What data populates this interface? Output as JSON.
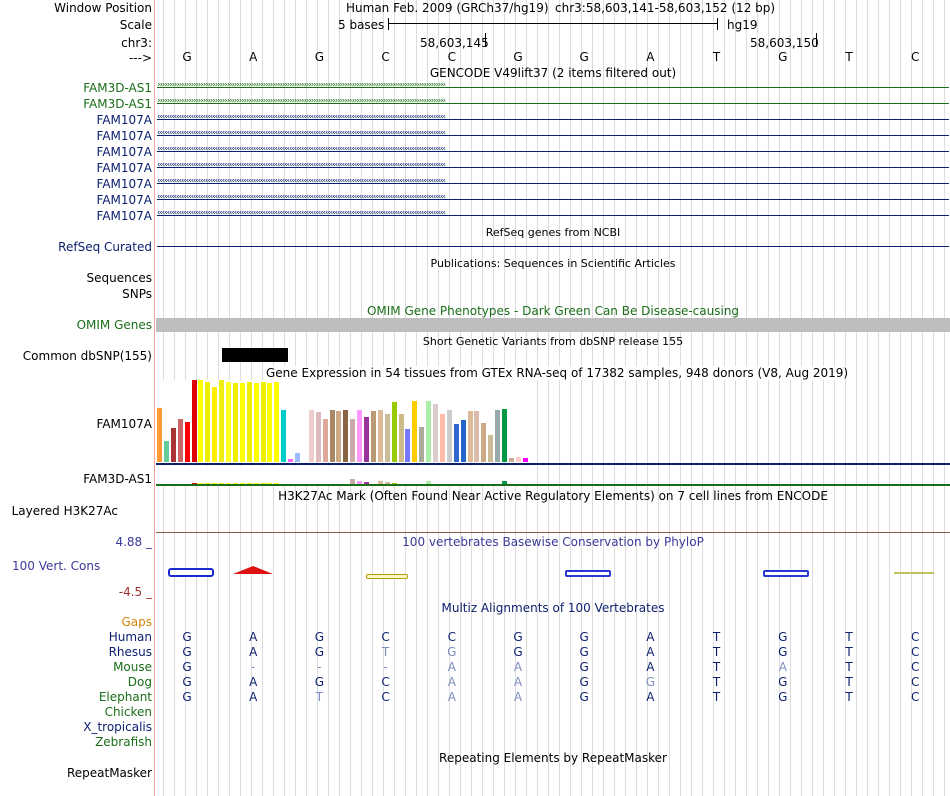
{
  "header": {
    "window_position_label": "Window Position",
    "assembly_title": "Human Feb. 2009 (GRCh37/hg19)",
    "position": "chr3:58,603,141-58,603,152 (12 bp)",
    "scale_label": "Scale",
    "scale_text": "5 bases",
    "scale_db": "hg19",
    "chrom_label": "chr3:",
    "coord_1": "58,603,145",
    "coord_2": "58,603,150",
    "strand_label": "--->"
  },
  "colors": {
    "dark_green": "#1a6e1a",
    "navy": "#0a1f6e",
    "omim_gray": "#bebebe",
    "phylop_blue": "#3a3a9a",
    "gaps_orange": "#d4860c",
    "divider": "#f3a3a3"
  },
  "bases": [
    "G",
    "A",
    "G",
    "C",
    "C",
    "G",
    "G",
    "A",
    "T",
    "G",
    "T",
    "C"
  ],
  "gencode": {
    "title": "GENCODE V49lift37 (2 items filtered out)",
    "tracks": [
      {
        "label": "FAM3D-AS1",
        "strand": "+"
      },
      {
        "label": "FAM3D-AS1",
        "strand": "+"
      },
      {
        "label": "FAM107A",
        "strand": "-"
      },
      {
        "label": "FAM107A",
        "strand": "-"
      },
      {
        "label": "FAM107A",
        "strand": "-"
      },
      {
        "label": "FAM107A",
        "strand": "-"
      },
      {
        "label": "FAM107A",
        "strand": "-"
      },
      {
        "label": "FAM107A",
        "strand": "-"
      },
      {
        "label": "FAM107A",
        "strand": "-"
      }
    ]
  },
  "refseq": {
    "title": "RefSeq genes from NCBI",
    "label": "RefSeq Curated"
  },
  "publications": {
    "title": "Publications: Sequences in Scientific Articles",
    "label_sequences": "Sequences",
    "label_snps": "SNPs"
  },
  "omim": {
    "title": "OMIM Gene Phenotypes - Dark Green Can Be Disease-causing",
    "label": "OMIM Genes"
  },
  "dbsnp": {
    "title": "Short Genetic Variants from dbSNP release 155",
    "label": "Common dbSNP(155)"
  },
  "gtex": {
    "title": "Gene Expression in 54 tissues from GTEx RNA-seq of 17382 samples, 948 donors (V8, Aug 2019)",
    "gene1_label": "FAM107A",
    "gene2_label": "FAM3D-AS1",
    "tissue_colors": [
      "#ff9933",
      "#66cc99",
      "#aa3333",
      "#cc6666",
      "#ff0000",
      "#dd0000",
      "#ffff00",
      "#eeee00",
      "#ffee00",
      "#eeee11",
      "#ffff22",
      "#eeee00",
      "#ffff00",
      "#eeee00",
      "#ffff00",
      "#eeee00",
      "#ffff00",
      "#ffff00",
      "#00cccc",
      "#ff66ff",
      "#99bbff",
      "#ffffff",
      "#eecccc",
      "#ddbbbb",
      "#ddaa99",
      "#aa8866",
      "#ccaa88",
      "#886644",
      "#ccaaaa",
      "#ff99ff",
      "#993399",
      "#bb9977",
      "#ddbb99",
      "#ccbb99",
      "#99cc00",
      "#ccbb88",
      "#7777ff",
      "#ffcc00",
      "#aaaa99",
      "#aaeeaa",
      "#ddcccc",
      "#ffbbaa",
      "#cccccc",
      "#3366cc",
      "#2266cc",
      "#ddbb99",
      "#ddbbaa",
      "#ccaa88",
      "#ccbb99",
      "#99aaaa",
      "#009944",
      "#ccaa99",
      "#ffcccc",
      "#ff00ff"
    ],
    "gene1_values": [
      0.66,
      0.26,
      0.42,
      0.52,
      0.49,
      1.0,
      1.0,
      0.98,
      0.92,
      1.0,
      0.98,
      0.96,
      0.96,
      0.98,
      0.96,
      0.98,
      0.96,
      0.98,
      0.64,
      0.04,
      0.11,
      0.01,
      0.63,
      0.61,
      0.52,
      0.64,
      0.62,
      0.64,
      0.52,
      0.64,
      0.55,
      0.62,
      0.64,
      0.59,
      0.73,
      0.58,
      0.4,
      0.74,
      0.43,
      0.74,
      0.71,
      0.58,
      0.64,
      0.46,
      0.51,
      0.62,
      0.62,
      0.47,
      0.33,
      0.64,
      0.65,
      0.05,
      0.06,
      0.05
    ],
    "gene2_values": [
      0.0,
      0.0,
      0.0,
      0.0,
      0.0,
      0.05,
      0.05,
      0.05,
      0.05,
      0.05,
      0.05,
      0.05,
      0.05,
      0.05,
      0.05,
      0.05,
      0.05,
      0.05,
      0.0,
      0.0,
      0.0,
      0.0,
      0.0,
      0.0,
      0.0,
      0.0,
      0.0,
      0.0,
      0.3,
      0.15,
      0.1,
      0.0,
      0.15,
      0.12,
      0.05,
      0.0,
      0.0,
      0.0,
      0.0,
      0.18,
      0.0,
      0.0,
      0.0,
      0.0,
      0.0,
      0.0,
      0.0,
      0.0,
      0.0,
      0.0,
      0.15,
      0.0,
      0.0,
      0.0
    ]
  },
  "h3k27ac": {
    "title": "H3K27Ac Mark (Often Found Near Active Regulatory Elements) on 7 cell lines from ENCODE",
    "label": "Layered H3K27Ac"
  },
  "conservation": {
    "title": "100 vertebrates Basewise Conservation by PhyloP",
    "label": "100 Vert. Cons",
    "max": "4.88 _",
    "min": "-4.5 _"
  },
  "multiz": {
    "title": "Multiz Alignments of 100 Vertebrates",
    "gaps_label": "Gaps",
    "species": [
      {
        "name": "Human",
        "bases": [
          "G",
          "A",
          "G",
          "C",
          "C",
          "G",
          "G",
          "A",
          "T",
          "G",
          "T",
          "C"
        ]
      },
      {
        "name": "Rhesus",
        "bases": [
          "G",
          "A",
          "G",
          "T",
          "G",
          "G",
          "G",
          "A",
          "T",
          "G",
          "T",
          "C"
        ]
      },
      {
        "name": "Mouse",
        "bases": [
          "G",
          "-",
          "-",
          "-",
          "A",
          "A",
          "G",
          "A",
          "T",
          "A",
          "T",
          "C"
        ]
      },
      {
        "name": "Dog",
        "bases": [
          "G",
          "A",
          "G",
          "C",
          "A",
          "A",
          "G",
          "G",
          "T",
          "G",
          "T",
          "C"
        ]
      },
      {
        "name": "Elephant",
        "bases": [
          "G",
          "A",
          "T",
          "C",
          "A",
          "A",
          "G",
          "A",
          "T",
          "G",
          "T",
          "C"
        ]
      },
      {
        "name": "Chicken",
        "bases": []
      },
      {
        "name": "X_tropicalis",
        "bases": []
      },
      {
        "name": "Zebrafish",
        "bases": []
      }
    ]
  },
  "repeatmasker": {
    "title": "Repeating Elements by RepeatMasker",
    "label": "RepeatMasker"
  }
}
